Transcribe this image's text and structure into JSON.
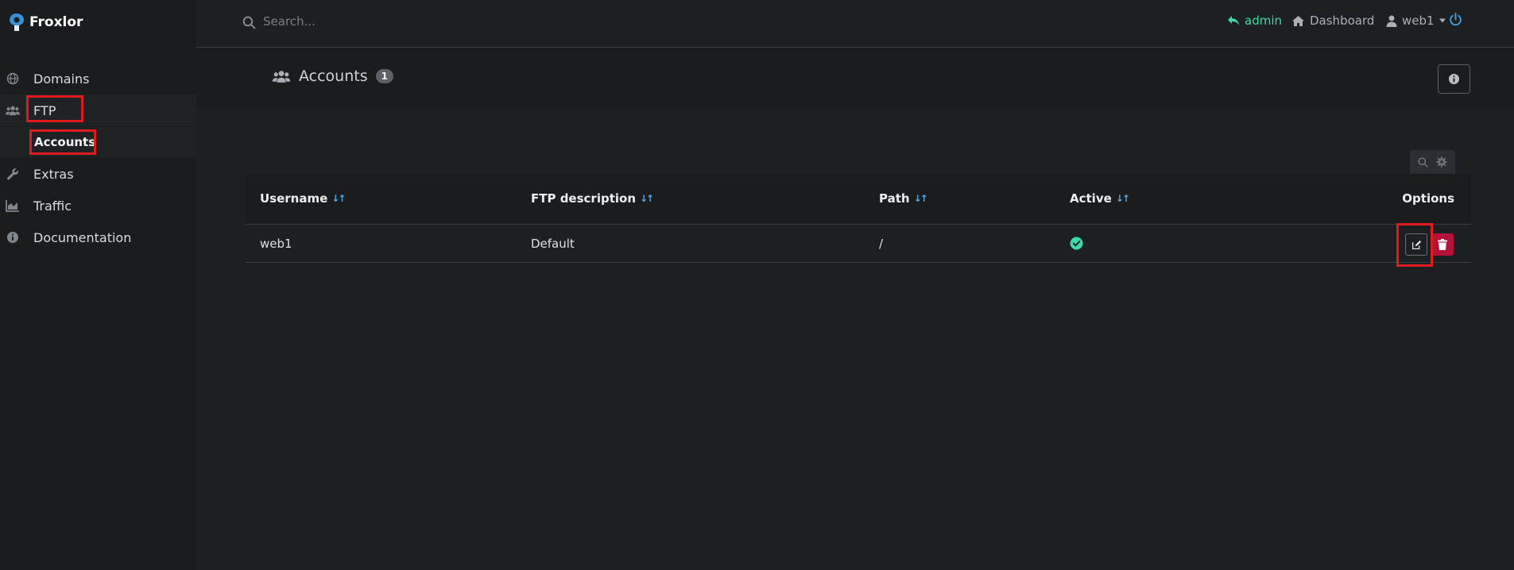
{
  "app": {
    "name": "Froxlor"
  },
  "sidebar": {
    "items": [
      {
        "label": "Domains",
        "icon": "globe-icon"
      },
      {
        "label": "FTP",
        "icon": "users-icon"
      },
      {
        "label": "Accounts",
        "icon": ""
      },
      {
        "label": "Extras",
        "icon": "wrench-icon"
      },
      {
        "label": "Traffic",
        "icon": "chart-area-icon"
      },
      {
        "label": "Documentation",
        "icon": "info-circle-icon"
      }
    ]
  },
  "topbar": {
    "search_placeholder": "Search...",
    "admin_label": "admin",
    "dashboard_label": "Dashboard",
    "user_label": "web1"
  },
  "page": {
    "title": "Accounts",
    "count": "1"
  },
  "table": {
    "columns": [
      "Username",
      "FTP description",
      "Path",
      "Active",
      "Options"
    ],
    "rows": [
      {
        "username": "web1",
        "description": "Default",
        "path": "/",
        "active": true
      }
    ]
  },
  "colors": {
    "accent_green": "#3fd9a9",
    "sort_blue": "#5aa7e0",
    "delete_red": "#b5123a",
    "highlight_red": "#e01b1b"
  }
}
